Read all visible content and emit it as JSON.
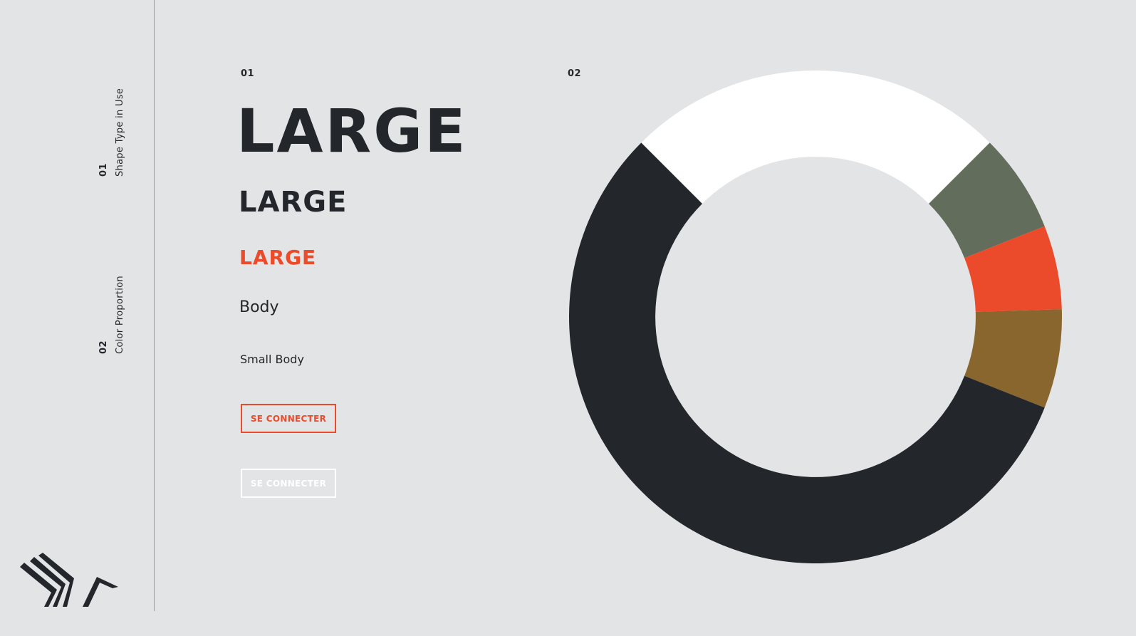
{
  "sidebar": {
    "items": [
      {
        "number": "01",
        "label": "Shape Type in Use"
      },
      {
        "number": "02",
        "label": "Color Proportion"
      }
    ]
  },
  "logo": {
    "icon": "bird-logo-icon"
  },
  "section1": {
    "number": "01",
    "headline_xl": "LARGE",
    "headline_lg": "LARGE",
    "headline_accent": "LARGE",
    "body": "Body",
    "small_body": "Small Body",
    "button_orange_label": "SE CONNECTER",
    "button_white_label": "SE CONNECTER"
  },
  "section2": {
    "number": "02"
  },
  "colors": {
    "background": "#e3e4e6",
    "dark": "#23272b",
    "accent": "#eb4b2a",
    "white": "#ffffff",
    "olive": "#636d5c",
    "brown": "#8a662f"
  },
  "chart_data": {
    "type": "pie",
    "categories": [
      "white",
      "olive",
      "orange",
      "brown",
      "dark"
    ],
    "values": [
      25,
      6.5,
      5.5,
      6.5,
      56.5
    ],
    "colors": [
      "#ffffff",
      "#636d5c",
      "#eb4b2a",
      "#8a662f",
      "#23272b"
    ],
    "start_angle_deg": -45,
    "inner_radius_ratio": 0.65
  }
}
